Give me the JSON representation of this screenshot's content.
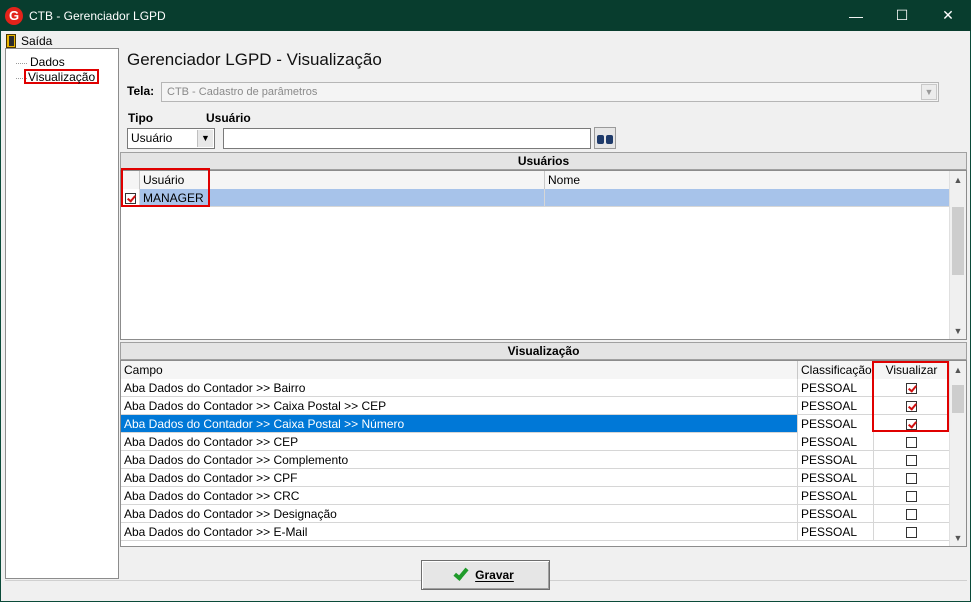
{
  "window": {
    "title": "CTB - Gerenciador LGPD",
    "logo": "G",
    "minimize_icon": "—",
    "maximize_icon": "☐",
    "close_icon": "✕"
  },
  "menu": {
    "exit_label": "Saída"
  },
  "tree": {
    "items": [
      {
        "label": "Dados"
      },
      {
        "label": "Visualização"
      }
    ]
  },
  "form": {
    "title": "Gerenciador LGPD - Visualização",
    "tela_label": "Tela:",
    "tela_value": "CTB - Cadastro de parâmetros",
    "tipo_label": "Tipo",
    "tipo_value": "Usuário",
    "usuario_label": "Usuário",
    "usuario_value": ""
  },
  "usuarios": {
    "header": "Usuários",
    "columns": [
      "Usuário",
      "Nome"
    ],
    "rows": [
      {
        "checked": true,
        "usuario": "MANAGER",
        "nome": ""
      }
    ]
  },
  "visualizacao": {
    "header": "Visualização",
    "columns": [
      "Campo",
      "Classificação",
      "Visualizar"
    ],
    "rows": [
      {
        "campo": "Aba Dados do Contador >> Bairro",
        "classificacao": "PESSOAL",
        "visualizar": true
      },
      {
        "campo": "Aba Dados do Contador >> Caixa Postal >> CEP",
        "classificacao": "PESSOAL",
        "visualizar": true
      },
      {
        "campo": "Aba Dados do Contador >> Caixa Postal >> Número",
        "classificacao": "PESSOAL",
        "visualizar": true
      },
      {
        "campo": "Aba Dados do Contador >> CEP",
        "classificacao": "PESSOAL",
        "visualizar": false
      },
      {
        "campo": "Aba Dados do Contador >> Complemento",
        "classificacao": "PESSOAL",
        "visualizar": false
      },
      {
        "campo": "Aba Dados do Contador >> CPF",
        "classificacao": "PESSOAL",
        "visualizar": false
      },
      {
        "campo": "Aba Dados do Contador >> CRC",
        "classificacao": "PESSOAL",
        "visualizar": false
      },
      {
        "campo": "Aba Dados do Contador >> Designação",
        "classificacao": "PESSOAL",
        "visualizar": false
      },
      {
        "campo": "Aba Dados do Contador >> E-Mail",
        "classificacao": "PESSOAL",
        "visualizar": false
      }
    ],
    "selected_row_index": 2
  },
  "buttons": {
    "save_label": "Gravar"
  },
  "colors": {
    "titlebar": "#083d2e",
    "selection_blue": "#0078d7",
    "user_selection": "#a7c3ea",
    "highlight_red": "#e00000",
    "logo_red": "#e2231a",
    "save_check_green": "#1f9a2a"
  }
}
